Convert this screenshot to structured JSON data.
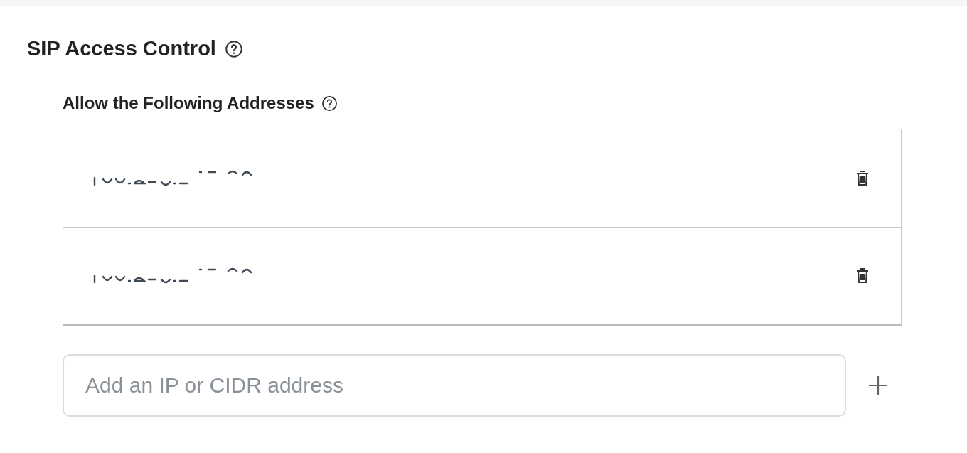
{
  "section": {
    "title": "SIP Access Control",
    "help": true
  },
  "allow_list": {
    "title": "Allow the Following Addresses",
    "help": true,
    "items": [
      {
        "redacted": true
      },
      {
        "redacted": true
      }
    ]
  },
  "add_field": {
    "placeholder": "Add an IP or CIDR address"
  }
}
